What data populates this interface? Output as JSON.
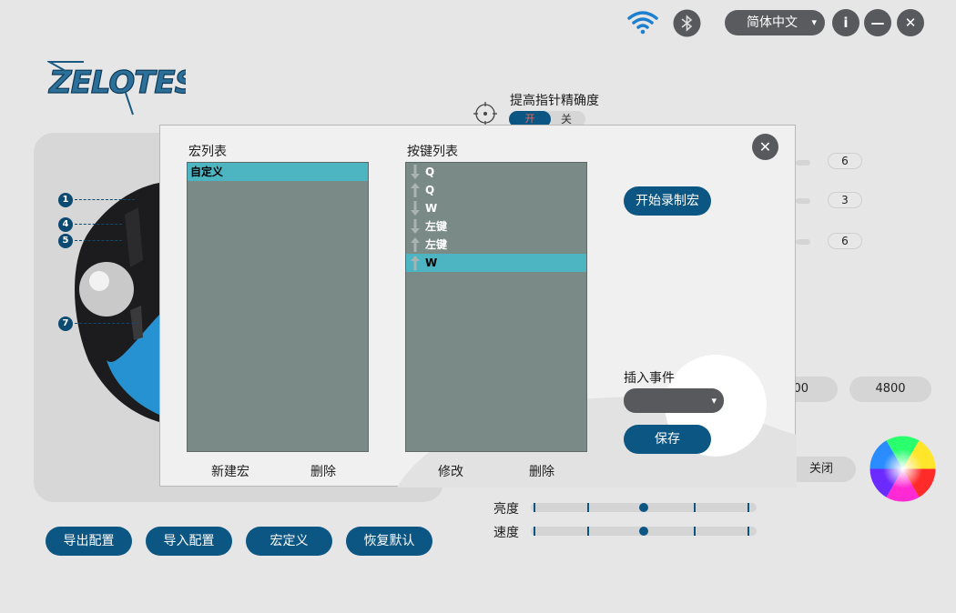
{
  "topbar": {
    "language": "简体中文",
    "language_caret": "▾",
    "info_icon": "i",
    "minimize_icon": "—",
    "close_icon": "✕"
  },
  "logo_text": "ZELOTES",
  "callouts": [
    "1",
    "4",
    "5",
    "7"
  ],
  "bottom_buttons": {
    "export": "导出配置",
    "import": "导入配置",
    "macro": "宏定义",
    "restore": "恢复默认"
  },
  "settings": {
    "precision_label": "提高指针精确度",
    "toggle_on": "开",
    "toggle_off": "关",
    "values": [
      "6",
      "3",
      "6"
    ],
    "dpi_left": "00",
    "dpi_right": "4800",
    "light_off": "关闭",
    "brightness_label": "亮度",
    "speed_label": "速度",
    "brightness_level": 0.5,
    "speed_level": 0.5
  },
  "modal": {
    "macro_list_title": "宏列表",
    "key_list_title": "按键列表",
    "macros": [
      {
        "name": "自定义",
        "selected": true
      }
    ],
    "keys": [
      {
        "dir": "down",
        "key": "Q",
        "selected": false
      },
      {
        "dir": "up",
        "key": "Q",
        "selected": false
      },
      {
        "dir": "down",
        "key": "W",
        "selected": false
      },
      {
        "dir": "down",
        "key": "左键",
        "selected": false
      },
      {
        "dir": "up",
        "key": "左键",
        "selected": false
      },
      {
        "dir": "up",
        "key": "W",
        "selected": true
      }
    ],
    "new_macro": "新建宏",
    "delete_macro": "删除",
    "modify_key": "修改",
    "delete_key": "删除",
    "start_record": "开始录制宏",
    "insert_event": "插入事件",
    "insert_select_value": "",
    "save": "保存",
    "close_icon": "✕"
  },
  "colors": {
    "accent": "#0c5683",
    "selected_row": "#4cb5c1",
    "list_bg": "#7a8a87",
    "background": "#e6e6e7"
  }
}
